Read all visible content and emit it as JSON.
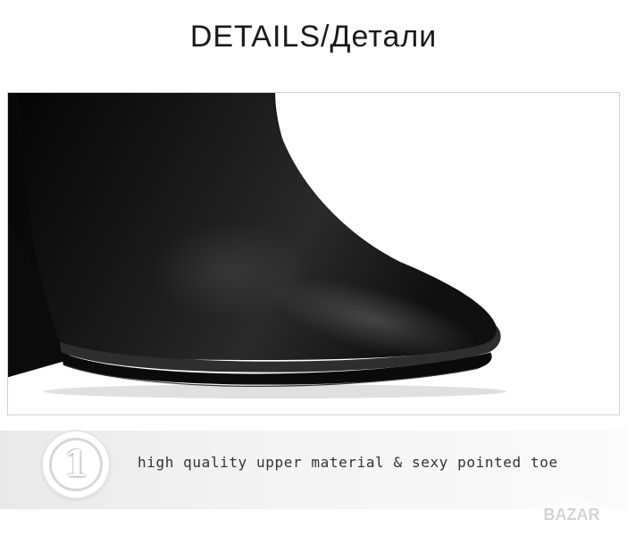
{
  "header": {
    "title": "DETAILS/Детали"
  },
  "product_image": {
    "icon": "pointed-toe-boot-closeup"
  },
  "feature": {
    "number": "1",
    "text": "high quality upper material & sexy pointed toe"
  },
  "watermark": {
    "text": "BAZAR"
  },
  "colors": {
    "leather": "#141414",
    "band": "#efefef",
    "frame_border": "#d2d2d2"
  }
}
